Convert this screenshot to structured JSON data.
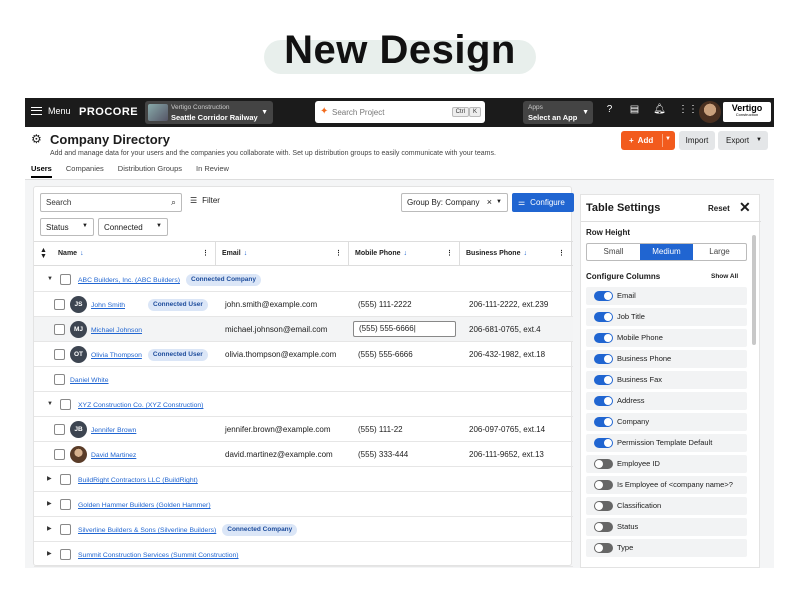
{
  "hero": {
    "title": "New Design"
  },
  "topbar": {
    "menu_label": "Menu",
    "logo": "PROCORE",
    "project_company": "Vertigo Construction",
    "project_name": "Seattle Corridor Railway",
    "search_placeholder": "Search Project",
    "kbd_ctrl": "Ctrl",
    "kbd_k": "K",
    "apps_label": "Apps",
    "apps_select": "Select an App",
    "brand": "Vertigo",
    "brand_sub": "Construction"
  },
  "page": {
    "title": "Company Directory",
    "subtitle": "Add and manage data for your users and the companies you collaborate with. Set up distribution groups to easily communicate with your teams.",
    "add_label": "Add",
    "import_label": "Import",
    "export_label": "Export"
  },
  "tabs": [
    {
      "label": "Users",
      "active": true
    },
    {
      "label": "Companies",
      "active": false
    },
    {
      "label": "Distribution Groups",
      "active": false
    },
    {
      "label": "In Review",
      "active": false
    }
  ],
  "filters": {
    "search_placeholder": "Search",
    "filter_label": "Filter",
    "status_label": "Status",
    "connected_label": "Connected",
    "groupby_label": "Group By: Company",
    "configure_label": "Configure"
  },
  "table": {
    "headers": [
      "Name",
      "Email",
      "Mobile Phone",
      "Business Phone"
    ],
    "rows": [
      {
        "type": "group",
        "expanded": true,
        "name": "ABC Builders, Inc. (ABC Builders)",
        "badge": "Connected Company"
      },
      {
        "type": "user",
        "initials": "JS",
        "name": "John Smith",
        "badge": "Connected User",
        "email": "john.smith@example.com",
        "mobile": "(555) 111-2222",
        "business": "206-111-2222, ext.239"
      },
      {
        "type": "user",
        "initials": "MJ",
        "name": "Michael Johnson",
        "badge": "",
        "email": "michael.johnson@email.com",
        "mobile": "(555) 555-6666",
        "business": "206-681-0765, ext.4",
        "editing": true
      },
      {
        "type": "user",
        "initials": "OT",
        "name": "Olivia Thompson",
        "badge": "Connected User",
        "email": "olivia.thompson@example.com",
        "mobile": "(555) 555-6666",
        "business": "206-432-1982, ext.18"
      },
      {
        "type": "user",
        "initials": "",
        "name": "Daniel White",
        "badge": "",
        "email": "",
        "mobile": "",
        "business": ""
      },
      {
        "type": "group",
        "expanded": true,
        "name": "XYZ Construction Co. (XYZ Construction)",
        "badge": ""
      },
      {
        "type": "user",
        "initials": "JB",
        "name": "Jennifer Brown",
        "badge": "",
        "email": "jennifer.brown@example.com",
        "mobile": "(555) 111-22",
        "business": "206-097-0765, ext.14"
      },
      {
        "type": "user",
        "initials": "photo",
        "name": "David Martinez",
        "badge": "",
        "email": "david.martinez@example.com",
        "mobile": "(555) 333-444",
        "business": "206-111-9652, ext.13"
      },
      {
        "type": "group",
        "expanded": false,
        "name": "BuildRight Contractors LLC (BuildRight)",
        "badge": ""
      },
      {
        "type": "group",
        "expanded": false,
        "name": "Golden Hammer Builders (Golden Hammer)",
        "badge": ""
      },
      {
        "type": "group",
        "expanded": false,
        "name": "Silverline Builders & Sons (Silverline Builders)",
        "badge": "Connected Company"
      },
      {
        "type": "group",
        "expanded": false,
        "name": "Summit Construction Services (Summit Construction)",
        "badge": ""
      }
    ]
  },
  "table_settings": {
    "title": "Table Settings",
    "reset_label": "Reset",
    "row_height_label": "Row Height",
    "row_heights": [
      "Small",
      "Medium",
      "Large"
    ],
    "row_height_selected": "Medium",
    "configure_columns_label": "Configure Columns",
    "show_all_label": "Show All",
    "columns": [
      {
        "label": "Email",
        "on": true
      },
      {
        "label": "Job Title",
        "on": true
      },
      {
        "label": "Mobile Phone",
        "on": true
      },
      {
        "label": "Business Phone",
        "on": true
      },
      {
        "label": "Business Fax",
        "on": true
      },
      {
        "label": "Address",
        "on": true
      },
      {
        "label": "Company",
        "on": true
      },
      {
        "label": "Permission Template Default",
        "on": true
      },
      {
        "label": "Employee ID",
        "on": false
      },
      {
        "label": "Is Employee of <company name>?",
        "on": false
      },
      {
        "label": "Classification",
        "on": false
      },
      {
        "label": "Status",
        "on": false
      },
      {
        "label": "Type",
        "on": false
      }
    ]
  },
  "colors": {
    "accent": "#2065d1",
    "brand_orange": "#f25b1d",
    "topbar": "#1b1b1b"
  }
}
